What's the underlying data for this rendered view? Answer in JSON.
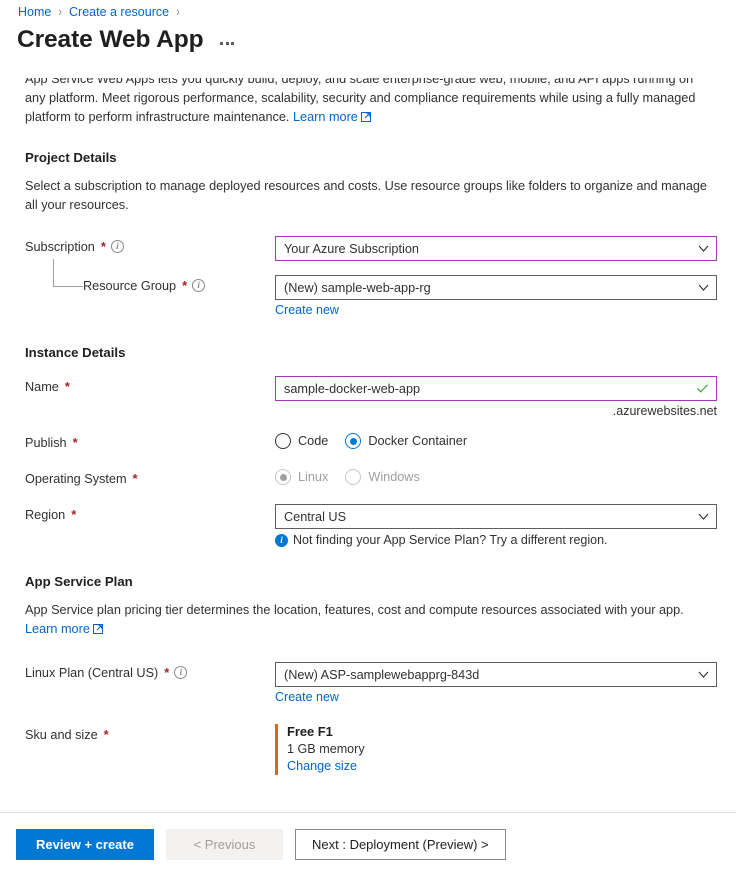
{
  "breadcrumb": {
    "items": [
      {
        "label": "Home"
      },
      {
        "label": "Create a resource"
      }
    ],
    "separator": "›"
  },
  "header": {
    "title": "Create Web App",
    "more_menu": "more-options"
  },
  "description": {
    "line1": "App Service Web Apps lets you quickly build, deploy, and scale enterprise-grade web, mobile, and API apps running on",
    "line2": "any platform. Meet rigorous performance, scalability, security and compliance requirements while using a fully managed",
    "line3": "platform to perform infrastructure maintenance.",
    "learn_more": "Learn more"
  },
  "project_details": {
    "heading": "Project Details",
    "subtext": "Select a subscription to manage deployed resources and costs. Use resource groups like folders to organize and manage all your resources.",
    "subscription": {
      "label": "Subscription",
      "required": "*",
      "value": "Your Azure Subscription",
      "focused_border": "#a437b8"
    },
    "resource_group": {
      "label": "Resource Group",
      "required": "*",
      "value": "(New) sample-web-app-rg",
      "create_new": "Create new"
    }
  },
  "instance_details": {
    "heading": "Instance Details",
    "name": {
      "label": "Name",
      "required": "*",
      "value": "sample-docker-web-app",
      "suffix": ".azurewebsites.net",
      "valid": true
    },
    "publish": {
      "label": "Publish",
      "required": "*",
      "options": [
        {
          "label": "Code",
          "selected": false
        },
        {
          "label": "Docker Container",
          "selected": true
        }
      ]
    },
    "operating_system": {
      "label": "Operating System",
      "required": "*",
      "disabled": true,
      "options": [
        {
          "label": "Linux",
          "selected": true
        },
        {
          "label": "Windows",
          "selected": false
        }
      ]
    },
    "region": {
      "label": "Region",
      "required": "*",
      "value": "Central US",
      "hint": "Not finding your App Service Plan? Try a different region."
    }
  },
  "app_service_plan": {
    "heading": "App Service Plan",
    "subtext": "App Service plan pricing tier determines the location, features, cost and compute resources associated with your app.",
    "learn_more": "Learn more",
    "linux_plan": {
      "label": "Linux Plan (Central US)",
      "required": "*",
      "value": "(New) ASP-samplewebapprg-843d",
      "create_new": "Create new"
    },
    "sku": {
      "label": "Sku and size",
      "required": "*",
      "name": "Free F1",
      "memory": "1 GB memory",
      "change_link": "Change size",
      "accent_color": "#d9681a"
    }
  },
  "footer": {
    "review_create": "Review + create",
    "previous": "< Previous",
    "next": "Next : Deployment (Preview) >"
  },
  "colors": {
    "accent": "#0078d4",
    "link": "#0066cc",
    "required": "#a4262c",
    "focus_purple": "#a437b8",
    "sku_accent": "#d9681a"
  }
}
